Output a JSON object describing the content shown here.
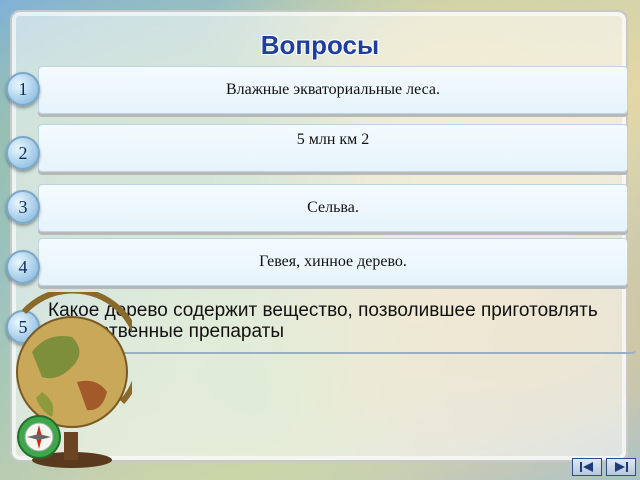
{
  "title": "Вопросы",
  "answers": [
    {
      "num": "1",
      "text": "Влажные экваториальные леса."
    },
    {
      "num": "2",
      "text": "5 млн км 2"
    },
    {
      "num": "3",
      "text": "Сельва."
    },
    {
      "num": "4",
      "text": "Гевея, хинное дерево."
    },
    {
      "num": "5",
      "text": "Какое дерево содержит вещество, позволившее приготовлять лекарственные препараты"
    }
  ],
  "icons": {
    "globe": "globe-illustration",
    "compass": "compass-icon",
    "prev": "prev-arrow-icon",
    "next": "next-arrow-icon"
  }
}
